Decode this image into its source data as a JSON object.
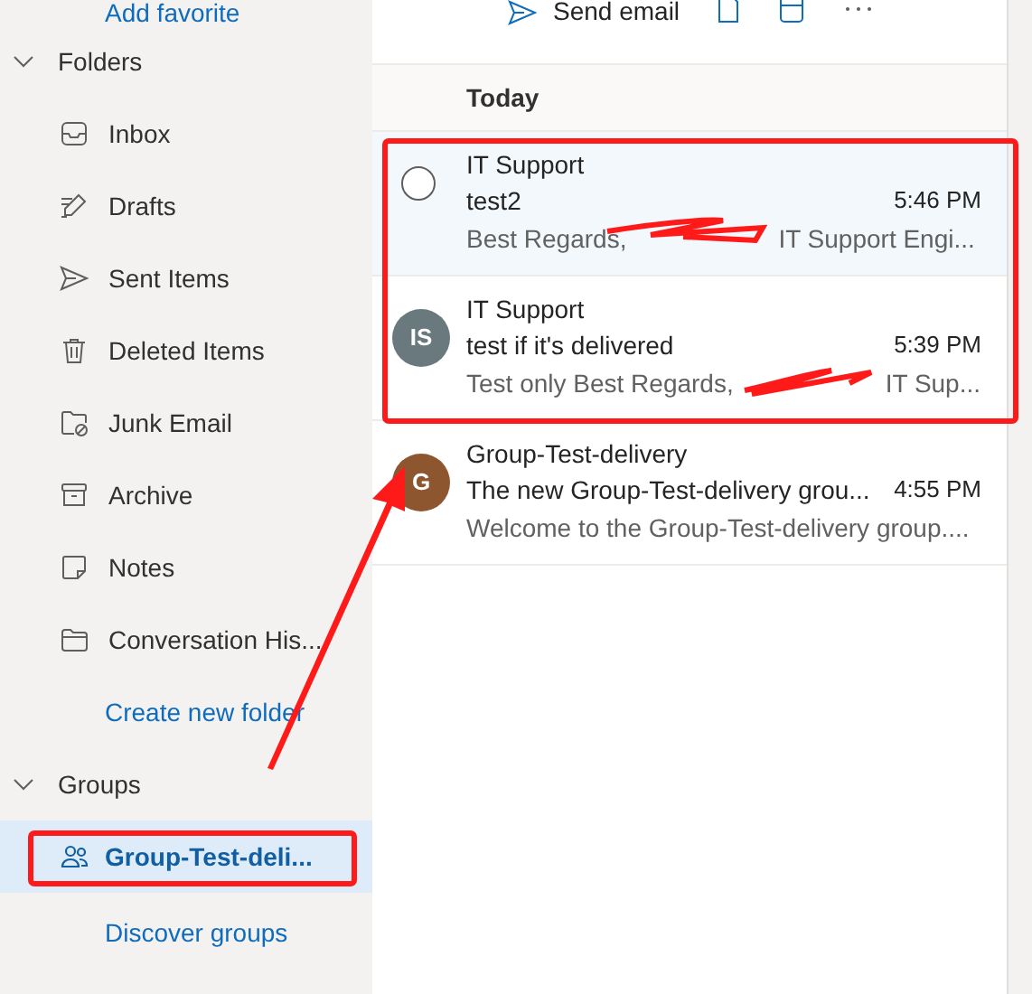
{
  "sidebar": {
    "top_link": "Add favorite",
    "folders": {
      "title": "Folders",
      "expanded": true,
      "items": [
        {
          "label": "Inbox",
          "kind": "inbox"
        },
        {
          "label": "Drafts",
          "kind": "drafts"
        },
        {
          "label": "Sent Items",
          "kind": "sent"
        },
        {
          "label": "Deleted Items",
          "kind": "trash"
        },
        {
          "label": "Junk Email",
          "kind": "junk"
        },
        {
          "label": "Archive",
          "kind": "archive"
        },
        {
          "label": "Notes",
          "kind": "notes"
        },
        {
          "label": "Conversation His...",
          "kind": "folder"
        }
      ],
      "create_link": "Create new folder"
    },
    "groups": {
      "title": "Groups",
      "expanded": true,
      "items": [
        {
          "label": "Group-Test-deli...",
          "selected": true
        }
      ],
      "discover_link": "Discover groups"
    }
  },
  "toolbar": {
    "send_label": "Send email"
  },
  "message_list": {
    "section": "Today",
    "messages": [
      {
        "sender": "IT Support",
        "subject": "test2",
        "time": "5:46 PM",
        "preview_before": "Best Regards,",
        "preview_after": "IT Support Engi...",
        "selected": true
      },
      {
        "sender": "IT Support",
        "subject": "test if it's delivered",
        "time": "5:39 PM",
        "preview_before": "Test only Best Regards,",
        "preview_after": "IT Sup...",
        "avatar": "IS",
        "color": "#69797e",
        "selected": false
      },
      {
        "sender": "Group-Test-delivery",
        "subject": "The new Group-Test-delivery grou...",
        "time": "4:55 PM",
        "preview_before": "Welcome to the Group-Test-delivery group....",
        "avatar": "G",
        "color": "#8e562e",
        "selected": false
      }
    ]
  }
}
